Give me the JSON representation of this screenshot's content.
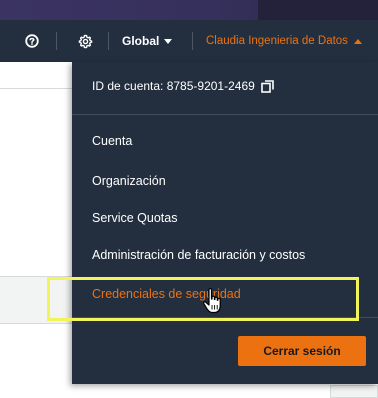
{
  "navbar": {
    "help_icon": "help-circle-icon",
    "settings_icon": "gear-icon",
    "region_label": "Global",
    "account_label": "Claudia Ingenieria de Datos"
  },
  "account_menu": {
    "account_id": "ID de cuenta: 8785-9201-2469",
    "copy_icon": "copy-icon",
    "items": [
      {
        "label": "Cuenta",
        "active": false
      },
      {
        "label": "Organización",
        "active": false
      },
      {
        "label": "Service Quotas",
        "active": false
      },
      {
        "label": "Administración de facturación y costos",
        "active": false
      },
      {
        "label": "Credenciales de seguridad",
        "active": true
      }
    ],
    "logout_label": "Cerrar sesión"
  },
  "colors": {
    "navbar_bg": "#232f3e",
    "accent": "#ec7211",
    "highlight": "#f2f55a",
    "text": "#ffffff"
  },
  "pointer_icon": "hand-pointer-icon"
}
